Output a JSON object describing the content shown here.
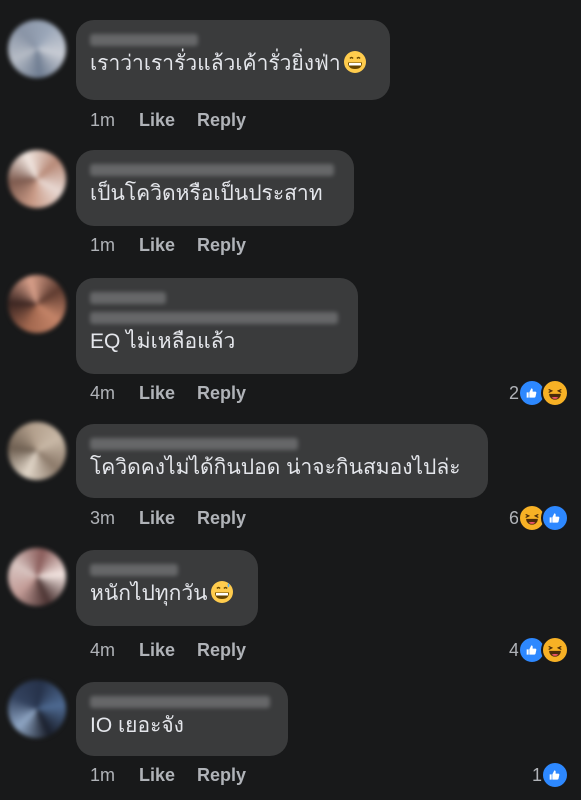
{
  "colors": {
    "background": "#18191a",
    "bubble": "#3a3b3c",
    "text": "#e4e6eb",
    "muted": "#b0b3b8",
    "like": "#2d88ff",
    "haha": "#f7b125"
  },
  "comments": [
    {
      "text": "เราว่าเรารั่วแล้วเค้ารั่วยิ่งฟ่า",
      "emoji": "grinning-face",
      "time": "1m",
      "like_label": "Like",
      "reply_label": "Reply"
    },
    {
      "text": "เป็นโควิดหรือเป็นประสาท",
      "time": "1m",
      "like_label": "Like",
      "reply_label": "Reply"
    },
    {
      "text": "EQ ไม่เหลือแล้ว",
      "time": "4m",
      "like_label": "Like",
      "reply_label": "Reply",
      "reaction_count": "2",
      "reactions": [
        "like-icon",
        "haha-icon"
      ]
    },
    {
      "text": "โควิดคงไม่ได้กินปอด น่าจะกินสมองไปล่ะ",
      "time": "3m",
      "like_label": "Like",
      "reply_label": "Reply",
      "reaction_count": "6",
      "reactions": [
        "haha-icon",
        "like-icon"
      ]
    },
    {
      "text": "หนักไปทุกวัน",
      "emoji": "grinning-sweat-face",
      "time": "4m",
      "like_label": "Like",
      "reply_label": "Reply",
      "reaction_count": "4",
      "reactions": [
        "like-icon",
        "haha-icon"
      ]
    },
    {
      "text": "IO เยอะจัง",
      "time": "1m",
      "like_label": "Like",
      "reply_label": "Reply",
      "reaction_count": "1",
      "reactions": [
        "like-icon"
      ]
    }
  ]
}
